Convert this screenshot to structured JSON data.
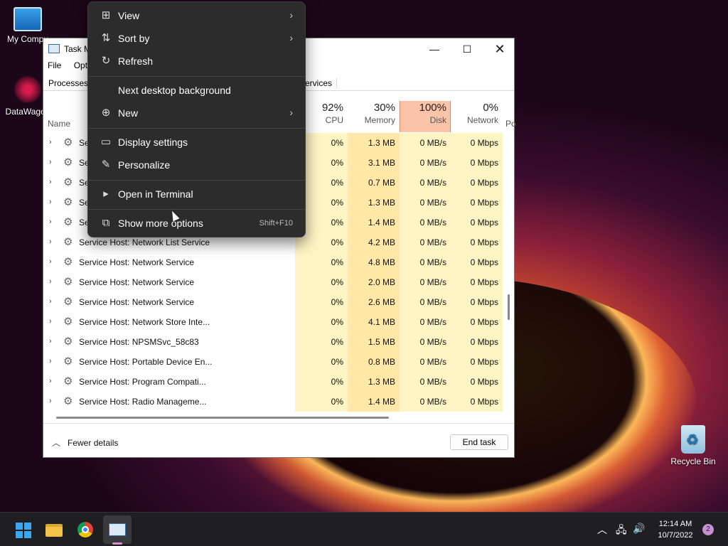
{
  "desktop": {
    "icons": [
      {
        "label": "My Compu",
        "icon": "monitor-icon"
      },
      {
        "label": "DataWagon",
        "icon": "datawagon-icon"
      },
      {
        "label": "Recycle Bin",
        "icon": "recycle-bin-icon"
      }
    ]
  },
  "task_manager": {
    "title": "Task M",
    "window_buttons": {
      "minimize": "—",
      "maximize": "☐",
      "close": "✕"
    },
    "menu": [
      "File",
      "Opti"
    ],
    "tabs": {
      "processes": "Processes",
      "services": "ervices"
    },
    "columns": {
      "name": "Name",
      "cpu": {
        "pct": "92%",
        "label": "CPU"
      },
      "memory": {
        "pct": "30%",
        "label": "Memory"
      },
      "disk": {
        "pct": "100%",
        "label": "Disk"
      },
      "network": {
        "pct": "0%",
        "label": "Network"
      },
      "power": "Po"
    },
    "rows": [
      {
        "name": "Se",
        "cpu": "0%",
        "memory": "1.3 MB",
        "disk": "0 MB/s",
        "network": "0 Mbps"
      },
      {
        "name": "Se",
        "cpu": "0%",
        "memory": "3.1 MB",
        "disk": "0 MB/s",
        "network": "0 Mbps"
      },
      {
        "name": "Se",
        "cpu": "0%",
        "memory": "0.7 MB",
        "disk": "0 MB/s",
        "network": "0 Mbps"
      },
      {
        "name": "Se",
        "cpu": "0%",
        "memory": "1.3 MB",
        "disk": "0 MB/s",
        "network": "0 Mbps"
      },
      {
        "name": "Se",
        "cpu": "0%",
        "memory": "1.4 MB",
        "disk": "0 MB/s",
        "network": "0 Mbps"
      },
      {
        "name": "Service Host: Network List Service",
        "cpu": "0%",
        "memory": "4.2 MB",
        "disk": "0 MB/s",
        "network": "0 Mbps"
      },
      {
        "name": "Service Host: Network Service",
        "cpu": "0%",
        "memory": "4.8 MB",
        "disk": "0 MB/s",
        "network": "0 Mbps"
      },
      {
        "name": "Service Host: Network Service",
        "cpu": "0%",
        "memory": "2.0 MB",
        "disk": "0 MB/s",
        "network": "0 Mbps"
      },
      {
        "name": "Service Host: Network Service",
        "cpu": "0%",
        "memory": "2.6 MB",
        "disk": "0 MB/s",
        "network": "0 Mbps"
      },
      {
        "name": "Service Host: Network Store Inte...",
        "cpu": "0%",
        "memory": "4.1 MB",
        "disk": "0 MB/s",
        "network": "0 Mbps"
      },
      {
        "name": "Service Host: NPSMSvc_58c83",
        "cpu": "0%",
        "memory": "1.5 MB",
        "disk": "0 MB/s",
        "network": "0 Mbps"
      },
      {
        "name": "Service Host: Portable Device En...",
        "cpu": "0%",
        "memory": "0.8 MB",
        "disk": "0 MB/s",
        "network": "0 Mbps"
      },
      {
        "name": "Service Host: Program Compati...",
        "cpu": "0%",
        "memory": "1.3 MB",
        "disk": "0 MB/s",
        "network": "0 Mbps"
      },
      {
        "name": "Service Host: Radio Manageme...",
        "cpu": "0%",
        "memory": "1.4 MB",
        "disk": "0 MB/s",
        "network": "0 Mbps"
      }
    ],
    "footer": {
      "fewer_details": "Fewer details",
      "end_task": "End task"
    }
  },
  "context_menu": {
    "items": [
      {
        "label": "View",
        "icon": "grid-icon",
        "submenu": true
      },
      {
        "label": "Sort by",
        "icon": "sort-icon",
        "submenu": true
      },
      {
        "label": "Refresh",
        "icon": "refresh-icon"
      },
      {
        "label": "Next desktop background",
        "icon": ""
      },
      {
        "label": "New",
        "icon": "plus-circle-icon",
        "submenu": true
      },
      {
        "label": "Display settings",
        "icon": "display-icon"
      },
      {
        "label": "Personalize",
        "icon": "pen-icon"
      },
      {
        "label": "Open in Terminal",
        "icon": "terminal-icon"
      },
      {
        "label": "Show more options",
        "icon": "more-options-icon",
        "shortcut": "Shift+F10"
      }
    ]
  },
  "taskbar": {
    "apps": [
      "start-icon",
      "file-explorer-icon",
      "chrome-icon",
      "task-manager-icon"
    ],
    "clock": {
      "time": "12:14 AM",
      "date": "10/7/2022"
    },
    "notification_count": "2"
  },
  "colors": {
    "disk_highlight": "#fbc3a8",
    "heat_light": "#fff4c4",
    "heat_mid": "#ffe8a8",
    "menu_bg": "#2c2c2c"
  }
}
